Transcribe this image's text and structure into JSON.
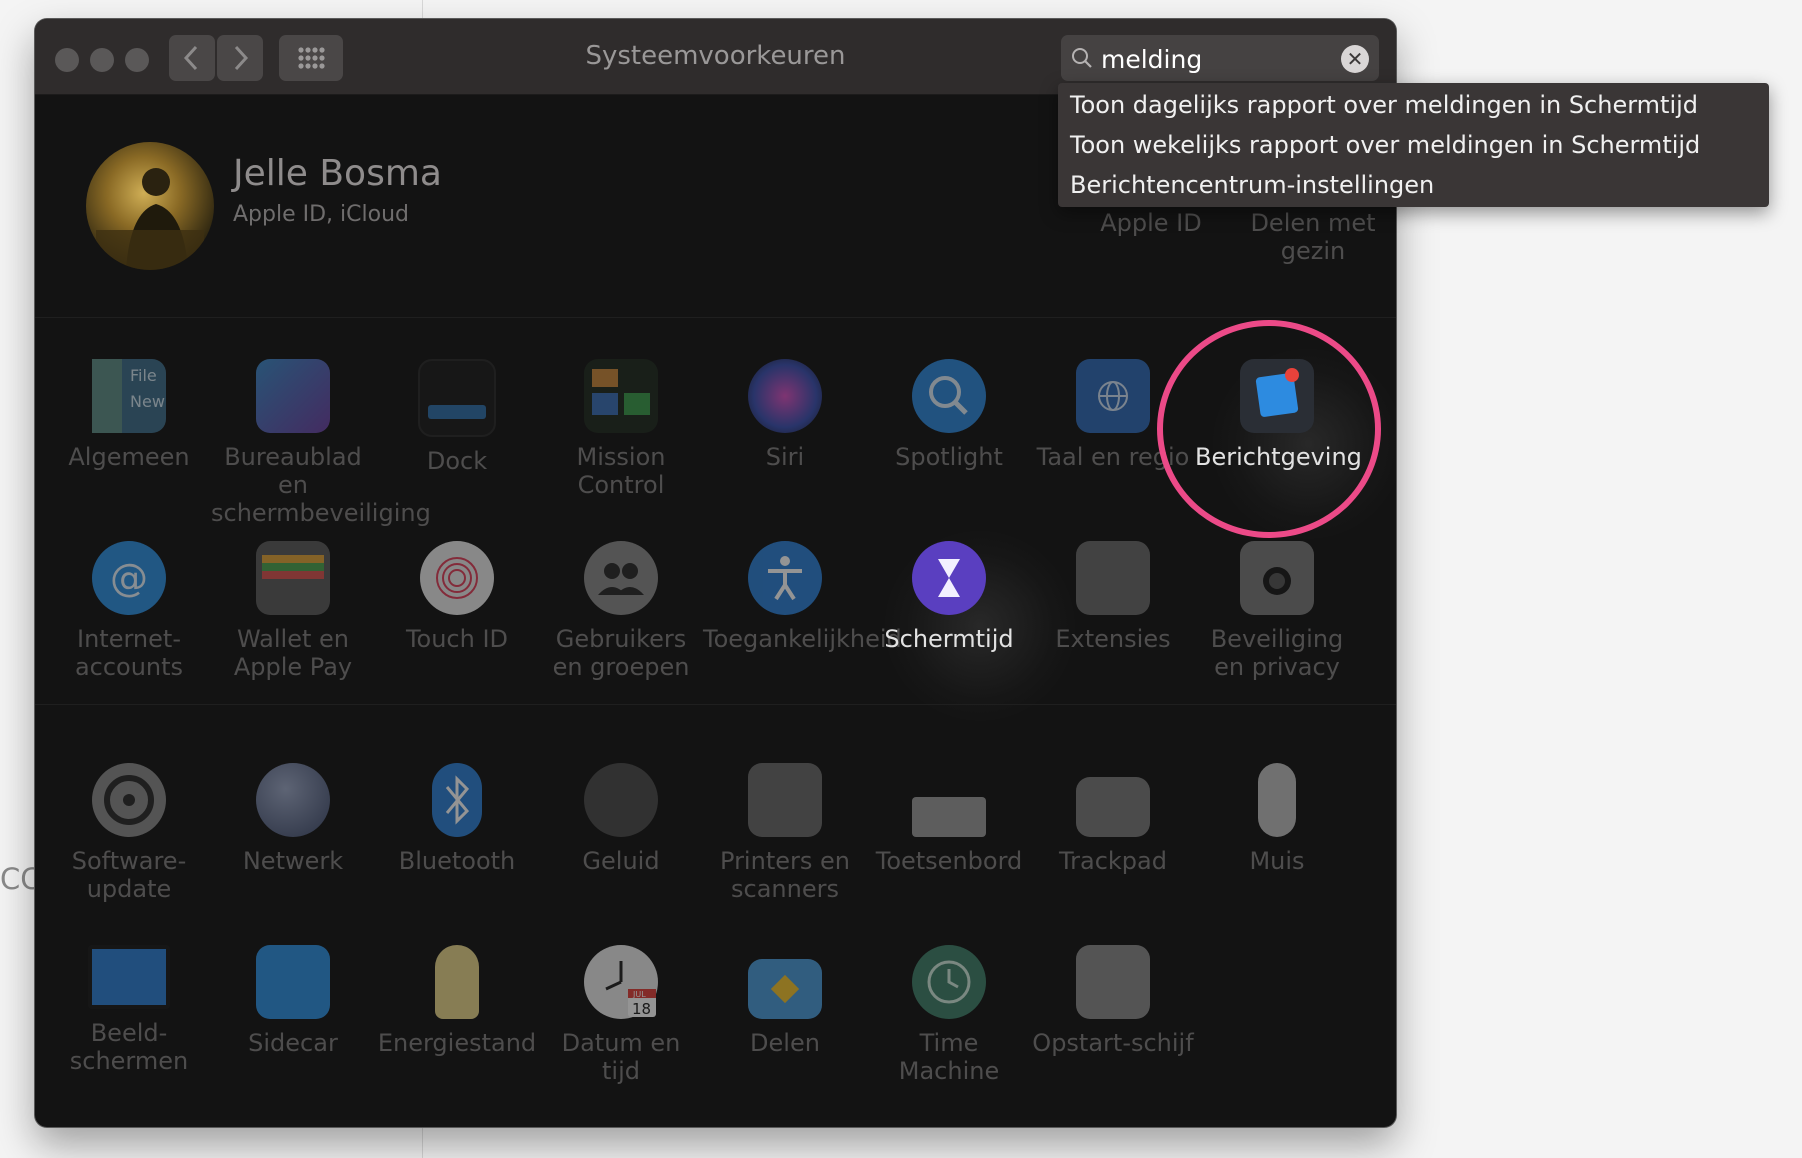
{
  "window": {
    "title": "Systeemvoorkeuren"
  },
  "search": {
    "value": "melding"
  },
  "search_results": [
    "Toon dagelijks rapport over meldingen in Schermtijd",
    "Toon wekelijks rapport over meldingen in Schermtijd",
    "Berichtencentrum-instellingen"
  ],
  "profile": {
    "name": "Jelle Bosma",
    "subtitle": "Apple ID, iCloud",
    "shortcuts": [
      {
        "label": "Apple ID",
        "icon": "apple-id-icon"
      },
      {
        "label": "Delen met gezin",
        "icon": "family-sharing-icon"
      }
    ]
  },
  "panes_row1": [
    {
      "label": "Algemeen",
      "icon": "general-icon"
    },
    {
      "label": "Bureaublad en schermbeveiliging",
      "icon": "desktop-icon"
    },
    {
      "label": "Dock",
      "icon": "dock-icon"
    },
    {
      "label": "Mission Control",
      "icon": "mission-control-icon"
    },
    {
      "label": "Siri",
      "icon": "siri-icon"
    },
    {
      "label": "Spotlight",
      "icon": "spotlight-icon"
    },
    {
      "label": "Taal en regio",
      "icon": "language-region-icon"
    },
    {
      "label": "Berichtgeving",
      "icon": "notifications-icon",
      "highlighted": true
    }
  ],
  "panes_row2": [
    {
      "label": "Internet-accounts",
      "icon": "internet-accounts-icon"
    },
    {
      "label": "Wallet en Apple Pay",
      "icon": "wallet-icon"
    },
    {
      "label": "Touch ID",
      "icon": "touch-id-icon"
    },
    {
      "label": "Gebruikers en groepen",
      "icon": "users-groups-icon"
    },
    {
      "label": "Toegankelijkheid",
      "icon": "accessibility-icon"
    },
    {
      "label": "Schermtijd",
      "icon": "screen-time-icon",
      "highlighted": true
    },
    {
      "label": "Extensies",
      "icon": "extensions-icon"
    },
    {
      "label": "Beveiliging en privacy",
      "icon": "security-privacy-icon"
    }
  ],
  "panes_row3": [
    {
      "label": "Software-update",
      "icon": "software-update-icon"
    },
    {
      "label": "Netwerk",
      "icon": "network-icon"
    },
    {
      "label": "Bluetooth",
      "icon": "bluetooth-icon"
    },
    {
      "label": "Geluid",
      "icon": "sound-icon"
    },
    {
      "label": "Printers en scanners",
      "icon": "printers-icon"
    },
    {
      "label": "Toetsenbord",
      "icon": "keyboard-icon"
    },
    {
      "label": "Trackpad",
      "icon": "trackpad-icon"
    },
    {
      "label": "Muis",
      "icon": "mouse-icon"
    }
  ],
  "panes_row4": [
    {
      "label": "Beeld-schermen",
      "icon": "displays-icon"
    },
    {
      "label": "Sidecar",
      "icon": "sidecar-icon"
    },
    {
      "label": "Energiestand",
      "icon": "energy-saver-icon"
    },
    {
      "label": "Datum en tijd",
      "icon": "date-time-icon",
      "badge": "18",
      "badge_month": "JUL"
    },
    {
      "label": "Delen",
      "icon": "sharing-icon"
    },
    {
      "label": "Time Machine",
      "icon": "time-machine-icon"
    },
    {
      "label": "Opstart-schijf",
      "icon": "startup-disk-icon"
    }
  ],
  "background_fragment": "CC",
  "colors": {
    "highlight_ring": "#ec4a88",
    "window_bg": "#131313",
    "titlebar_bg": "#2f2c2c"
  }
}
